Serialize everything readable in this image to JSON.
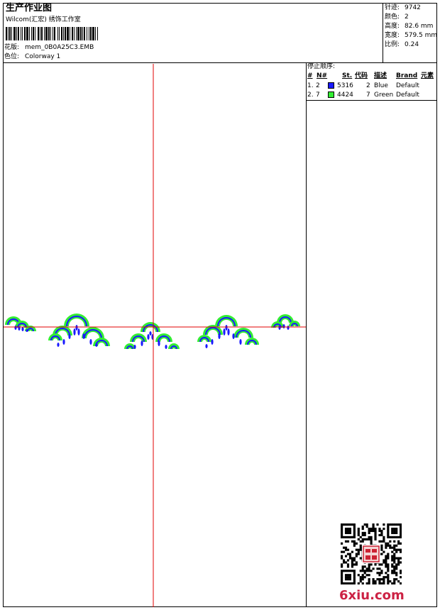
{
  "header": {
    "title": "生产作业图",
    "studio": "Wilcom(汇宏) 绣饰工作室",
    "design_label": "花版:",
    "design_value": "mem_0B0A25C3.EMB",
    "colorway_label": "色位:",
    "colorway_value": "Colorway 1"
  },
  "stats": {
    "stitches_label": "针迹:",
    "stitches_value": "9742",
    "colors_label": "颜色:",
    "colors_value": "2",
    "height_label": "高度:",
    "height_value": "82.6 mm",
    "width_label": "宽度:",
    "width_value": "579.5 mm",
    "scale_label": "比例:",
    "scale_value": "0.24"
  },
  "stop_sequence": {
    "label": "停止顺序:",
    "columns": [
      "#",
      "N#",
      "St.",
      "代码",
      "描述",
      "Brand",
      "元素"
    ],
    "rows": [
      {
        "seq": "1.",
        "needle": "2",
        "color": "#1a1aff",
        "stitches": "5316",
        "code": "2",
        "desc": "Blue",
        "brand": "Default"
      },
      {
        "seq": "2.",
        "needle": "7",
        "color": "#33ee33",
        "stitches": "4424",
        "code": "7",
        "desc": "Green",
        "brand": "Default"
      }
    ]
  },
  "canvas": {
    "axis_color": "#e00000",
    "fill_green": "#33ee33",
    "fill_blue": "#1a1aff"
  },
  "watermark": {
    "text": "6xiu.com"
  }
}
